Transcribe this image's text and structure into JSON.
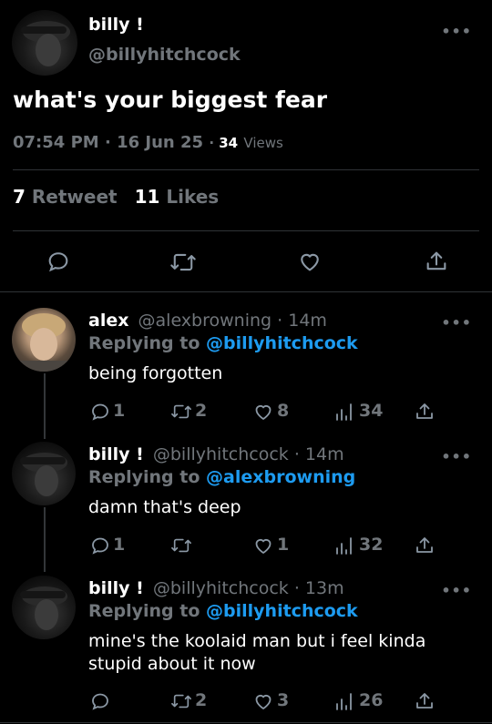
{
  "main_tweet": {
    "display_name": "billy !",
    "handle": "@billyhitchcock",
    "text": "what's your biggest fear",
    "time": "07:54 PM",
    "date": "16 Jun 25",
    "views_count": "34",
    "views_label": "Views",
    "retweets_count": "7",
    "retweets_label": "Retweet",
    "likes_count": "11",
    "likes_label": "Likes"
  },
  "replies": [
    {
      "display_name": "alex",
      "handle": "@alexbrowning",
      "time": "· 14m",
      "replying_label": "Replying to",
      "replying_to": "@billyhitchcock",
      "text": "being forgotten",
      "reply_count": "1",
      "retweet_count": "2",
      "like_count": "8",
      "view_count": "34"
    },
    {
      "display_name": "billy !",
      "handle": "@billyhitchcock",
      "time": "· 14m",
      "replying_label": "Replying to",
      "replying_to": "@alexbrowning",
      "text": "damn that's deep",
      "reply_count": "1",
      "retweet_count": "",
      "like_count": "1",
      "view_count": "32"
    },
    {
      "display_name": "billy !",
      "handle": "@billyhitchcock",
      "time": "· 13m",
      "replying_label": "Replying to",
      "replying_to": "@billyhitchcock",
      "text": "mine's the koolaid man but i feel kinda stupid about it now",
      "reply_count": "",
      "retweet_count": "2",
      "like_count": "3",
      "view_count": "26"
    }
  ],
  "more_glyph": "•••",
  "colors": {
    "accent": "#1d9bf0",
    "muted": "#71767b",
    "divider": "#2f3336",
    "background": "#000000"
  },
  "icons": [
    "reply-icon",
    "retweet-icon",
    "like-icon",
    "views-icon",
    "share-icon",
    "more-icon"
  ]
}
